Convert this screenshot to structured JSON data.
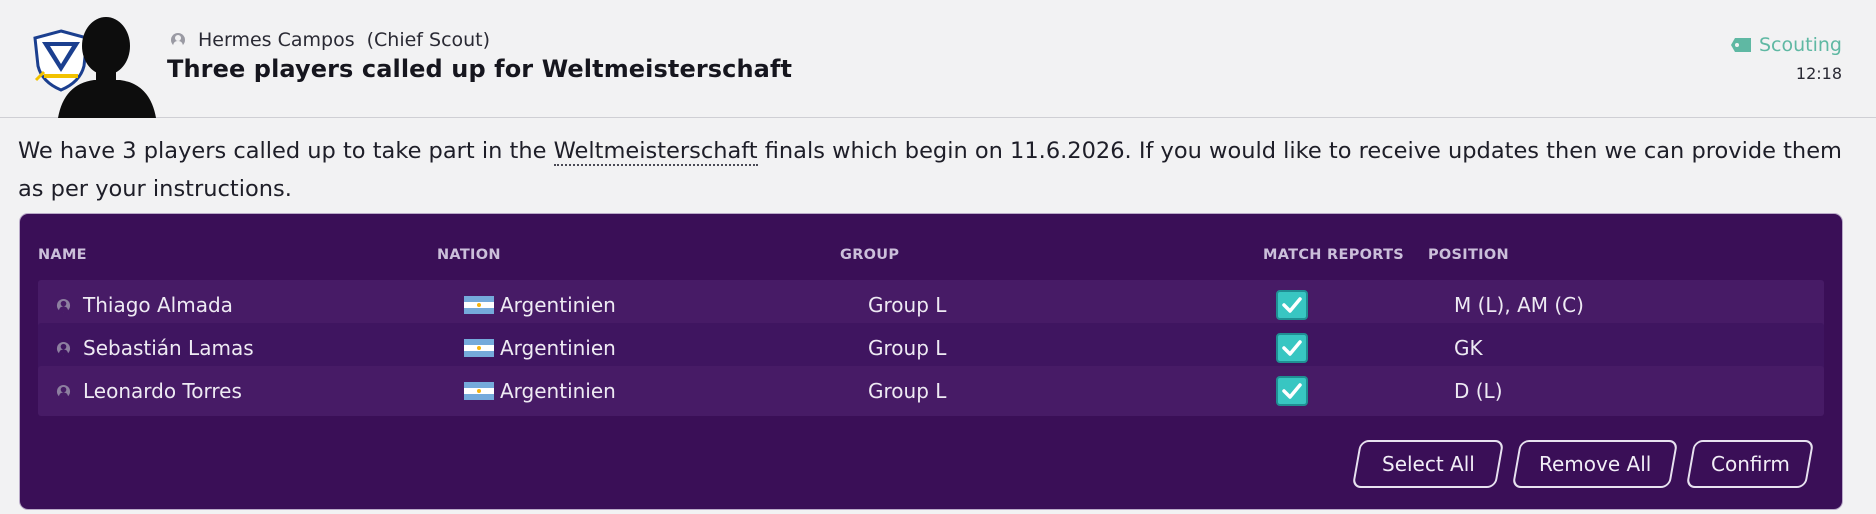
{
  "message": {
    "sender_name": "Hermes Campos",
    "sender_role": "(Chief Scout)",
    "title": "Three players called up for Weltmeisterschaft",
    "category": "Scouting",
    "time": "12:18",
    "body_before": "We have 3 players called up to take part in the ",
    "body_link": "Weltmeisterschaft",
    "body_after": " finals which begin on 11.6.2026. If you would like to receive updates then we can provide them as per your instructions."
  },
  "table": {
    "columns": [
      "NAME",
      "NATION",
      "GROUP",
      "MATCH REPORTS",
      "POSITION"
    ],
    "rows": [
      {
        "name": "Thiago Almada",
        "nation": "Argentinien",
        "group": "Group L",
        "match_reports": true,
        "position": "M (L), AM (C)"
      },
      {
        "name": "Sebastián Lamas",
        "nation": "Argentinien",
        "group": "Group L",
        "match_reports": true,
        "position": "GK"
      },
      {
        "name": "Leonardo Torres",
        "nation": "Argentinien",
        "group": "Group L",
        "match_reports": true,
        "position": "D (L)"
      }
    ]
  },
  "buttons": {
    "select_all": "Select All",
    "remove_all": "Remove All",
    "confirm": "Confirm"
  },
  "colors": {
    "panel_bg": "#3a0f57",
    "row_bg": "#471b66",
    "checkbox": "#38c6c2",
    "category_accent": "#5fb8a3"
  },
  "icons": {
    "sender": "person-icon",
    "category": "tag-icon",
    "checkbox": "checkmark-icon",
    "nation": "argentina-flag-icon",
    "club": "club-badge-icon"
  }
}
